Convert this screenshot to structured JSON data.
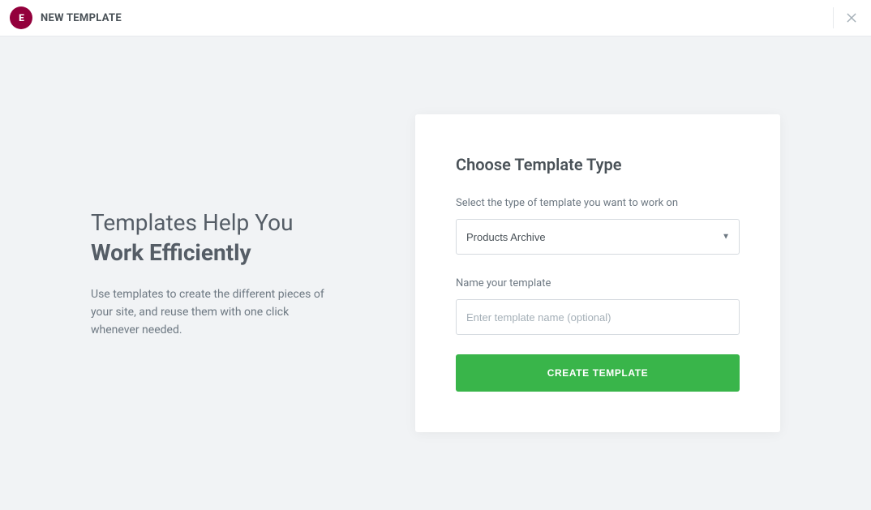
{
  "header": {
    "logo_text": "E",
    "title": "New Template"
  },
  "intro": {
    "heading_line1": "Templates Help You",
    "heading_line2": "Work Efficiently",
    "paragraph": "Use templates to create the different pieces of your site, and reuse them with one click whenever needed."
  },
  "form": {
    "heading": "Choose Template Type",
    "type_label": "Select the type of template you want to work on",
    "type_selected": "Products Archive",
    "name_label": "Name your template",
    "name_placeholder": "Enter template name (optional)",
    "name_value": "",
    "submit_label": "Create Template"
  }
}
